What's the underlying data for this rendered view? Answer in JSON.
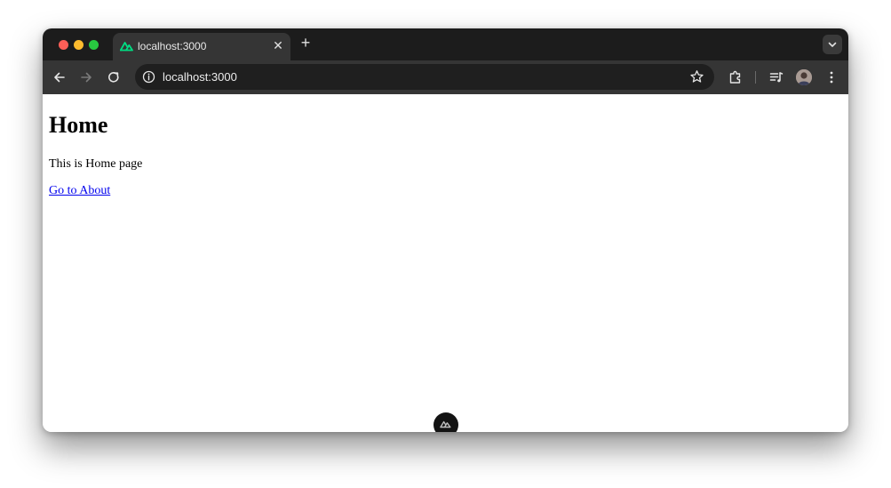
{
  "browser": {
    "tab": {
      "title": "localhost:3000",
      "favicon": "nuxt-logo-icon",
      "close_glyph": "✕"
    },
    "new_tab_glyph": "+",
    "address_bar": {
      "url": "localhost:3000"
    },
    "icons": {
      "back": "back-arrow-icon",
      "forward": "forward-arrow-icon",
      "reload": "reload-icon",
      "site_info": "info-icon",
      "bookmark": "star-icon",
      "extensions": "puzzle-icon",
      "media": "media-queue-icon",
      "profile": "avatar",
      "menu": "kebab-menu-icon",
      "tab_search": "chevron-down-icon"
    },
    "colors": {
      "titlebar": "#1c1c1c",
      "toolbar": "#353535",
      "omnibox": "#1f1f1f",
      "nuxt_green": "#00dc82"
    }
  },
  "page": {
    "heading": "Home",
    "text": "This is Home page",
    "link": "Go to About",
    "link_color": "#0000ee"
  }
}
